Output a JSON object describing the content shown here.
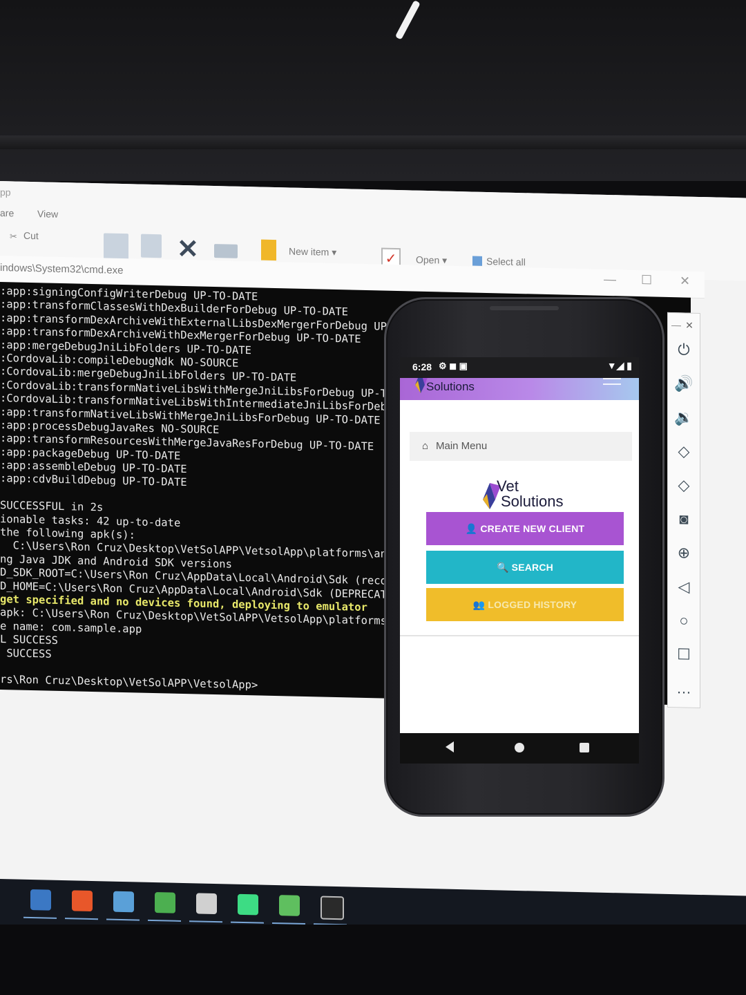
{
  "explorer": {
    "app_fragment": "pp",
    "tabs": [
      "are",
      "View"
    ],
    "cut_label": "Cut",
    "new_item_label": "New item",
    "open_label": "Open",
    "select_all_label": "Select all"
  },
  "cmd_window": {
    "title": "indows\\System32\\cmd.exe",
    "controls": [
      "—",
      "☐",
      "✕"
    ]
  },
  "console_lines": [
    ":app:signingConfigWriterDebug UP-TO-DATE",
    ":app:transformClassesWithDexBuilderForDebug UP-TO-DATE",
    ":app:transformDexArchiveWithExternalLibsDexMergerForDebug UP-TO",
    ":app:transformDexArchiveWithDexMergerForDebug UP-TO-DATE",
    ":app:mergeDebugJniLibFolders UP-TO-DATE",
    ":CordovaLib:compileDebugNdk NO-SOURCE",
    ":CordovaLib:mergeDebugJniLibFolders UP-TO-DATE",
    ":CordovaLib:transformNativeLibsWithMergeJniLibsForDebug UP-TO-D",
    ":CordovaLib:transformNativeLibsWithIntermediateJniLibsForDebug",
    ":app:transformNativeLibsWithMergeJniLibsForDebug UP-TO-DATE",
    ":app:processDebugJavaRes NO-SOURCE",
    ":app:transformResourcesWithMergeJavaResForDebug UP-TO-DATE",
    ":app:packageDebug UP-TO-DATE",
    ":app:assembleDebug UP-TO-DATE",
    ":app:cdvBuildDebug UP-TO-DATE",
    "",
    "SUCCESSFUL in 2s",
    "ionable tasks: 42 up-to-date",
    "the following apk(s):",
    "  C:\\Users\\Ron Cruz\\Desktop\\VetSolAPP\\VetsolApp\\platforms\\andro",
    "ng Java JDK and Android SDK versions",
    "D_SDK_ROOT=C:\\Users\\Ron Cruz\\AppData\\Local\\Android\\Sdk (recommen",
    "D_HOME=C:\\Users\\Ron Cruz\\AppData\\Local\\Android\\Sdk (DEPRECATED)",
    "get specified and no devices found, deploying to emulator",
    "apk: C:\\Users\\Ron Cruz\\Desktop\\VetSolAPP\\VetsolApp\\platforms\\and",
    "e name: com.sample.app",
    "L SUCCESS",
    " SUCCESS",
    "",
    "rs\\Ron Cruz\\Desktop\\VetSolAPP\\VetsolApp>"
  ],
  "console_warn_line_index": 23,
  "emulator_toolbar": {
    "close": "✕",
    "minimize": "—",
    "items": [
      {
        "name": "power-icon",
        "glyph": "⏻"
      },
      {
        "name": "volume-up-icon",
        "glyph": "🔊"
      },
      {
        "name": "volume-down-icon",
        "glyph": "🔉"
      },
      {
        "name": "rotate-left-icon",
        "glyph": "◇"
      },
      {
        "name": "rotate-right-icon",
        "glyph": "◇"
      },
      {
        "name": "camera-icon",
        "glyph": "◙"
      },
      {
        "name": "zoom-icon",
        "glyph": "⊕"
      },
      {
        "name": "back-icon",
        "glyph": "◁"
      },
      {
        "name": "home-icon",
        "glyph": "○"
      },
      {
        "name": "overview-icon",
        "glyph": "☐"
      },
      {
        "name": "more-icon",
        "glyph": "…"
      }
    ]
  },
  "phone": {
    "status_time": "6:28",
    "status_icons": "⚙ ◼ ▣",
    "status_right": "▼◢ ▮",
    "logo_line1": "Vet",
    "logo_line2": "Solutions",
    "main_menu_label": "Main Menu",
    "buttons": {
      "create": "CREATE NEW CLIENT",
      "search": "SEARCH",
      "logged": "LOGGED HISTORY"
    }
  },
  "colors": {
    "header_gradient_start": "#a966d6",
    "header_gradient_end": "#a6c8ee",
    "create_button": "#a854d2",
    "search_button": "#22b6c8",
    "logged_button": "#f0bd2a",
    "console_warning": "#e8e86a"
  },
  "taskbar_icons": [
    "file-explorer-icon",
    "firefox-icon",
    "app-icon",
    "chrome-icon",
    "photos-icon",
    "android-studio-icon",
    "app-green-icon",
    "cmd-icon"
  ]
}
